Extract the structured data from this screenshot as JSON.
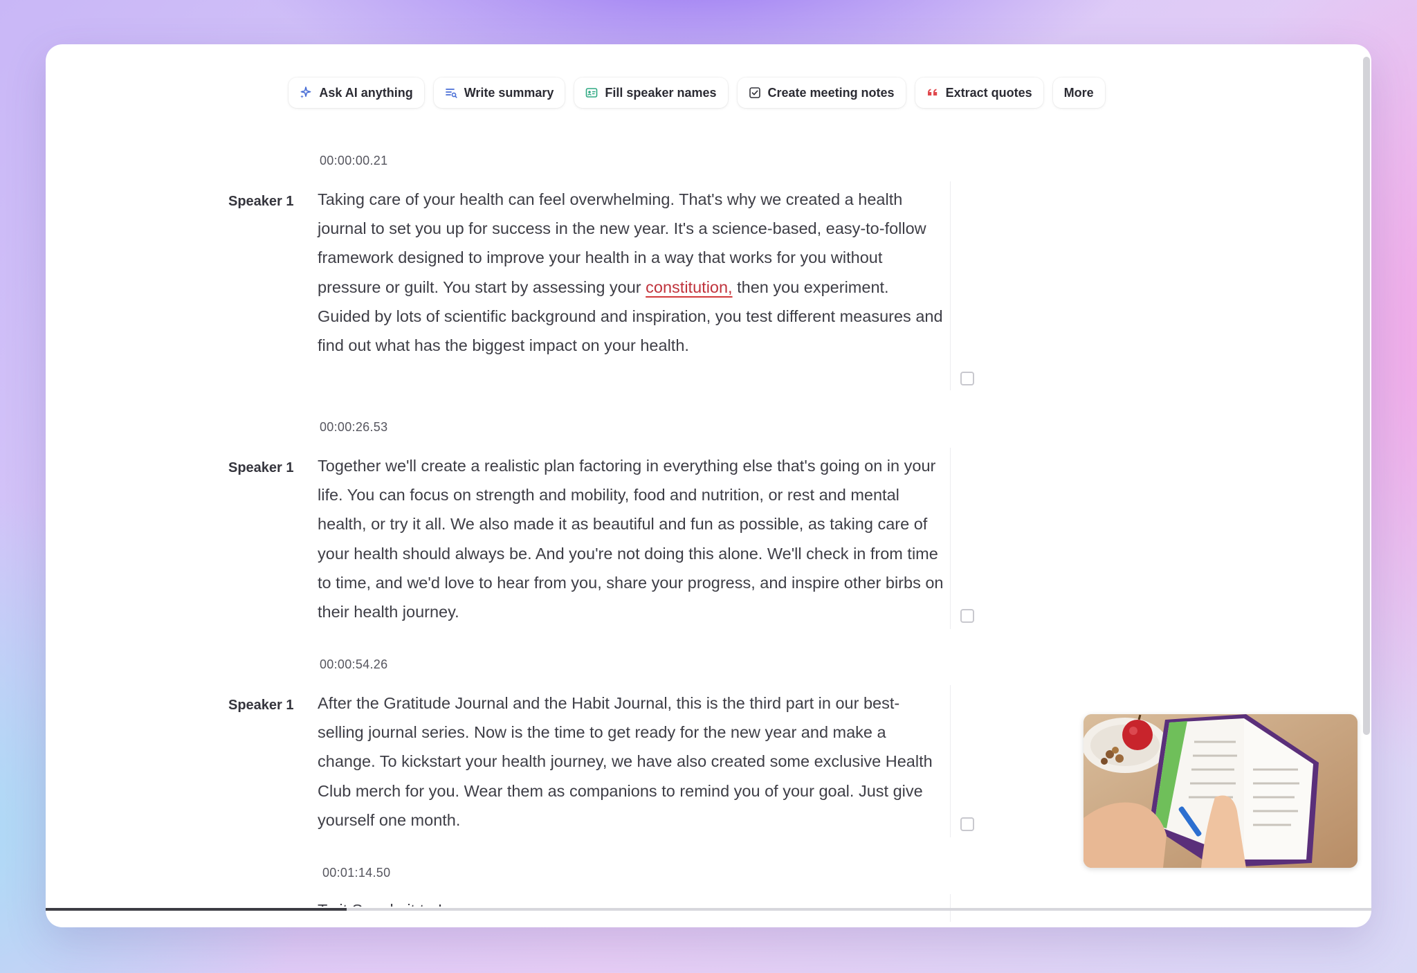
{
  "toolbar": {
    "items": [
      {
        "label": "Ask AI anything",
        "icon": "sparkle-icon"
      },
      {
        "label": "Write summary",
        "icon": "summary-lines-icon"
      },
      {
        "label": "Fill speaker names",
        "icon": "id-card-icon"
      },
      {
        "label": "Create meeting notes",
        "icon": "checkbox-icon"
      },
      {
        "label": "Extract quotes",
        "icon": "quote-icon"
      },
      {
        "label": "More",
        "icon": ""
      }
    ]
  },
  "segments": [
    {
      "timestamp": "00:00:00.21",
      "speaker": "Speaker 1",
      "text_before": "Taking care of your health can feel overwhelming. That's why we created a health journal to set you up for success in the new year. It's a science-based, easy-to-follow framework designed to improve your health in a way that works for you without pressure or guilt. You start by assessing your ",
      "flagged_word": "constitution,",
      "text_after": " then you experiment. Guided by lots of scientific background and inspiration, you test different measures and find out what has the biggest impact on your health."
    },
    {
      "timestamp": "00:00:26.53",
      "speaker": "Speaker 1",
      "text": "Together we'll create a realistic plan factoring in everything else that's going on in your life. You can focus on strength and mobility, food and nutrition, or rest and mental health, or try it all. We also made it as beautiful and fun as possible, as taking care of your health should always be. And you're not doing this alone. We'll check in from time to time, and we'd love to hear from you, share your progress, and inspire other birbs on their health journey."
    },
    {
      "timestamp": "00:00:54.26",
      "speaker": "Speaker 1",
      "text": "After the Gratitude Journal and the Habit Journal, this is the third part in our best-selling journal series. Now is the time to get ready for the new year and make a change. To kickstart your health journey, we have also created some exclusive Health Club merch for you. Wear them as companions to remind you of your goal. Just give yourself one month."
    },
    {
      "timestamp": "00:01:14.50",
      "speaker": "",
      "text": "To it Say do it to I"
    }
  ],
  "playback": {
    "progress_fraction": 0.227
  },
  "colors": {
    "flag_underline": "#d33a3a",
    "progress_fill": "#3d3d44"
  }
}
